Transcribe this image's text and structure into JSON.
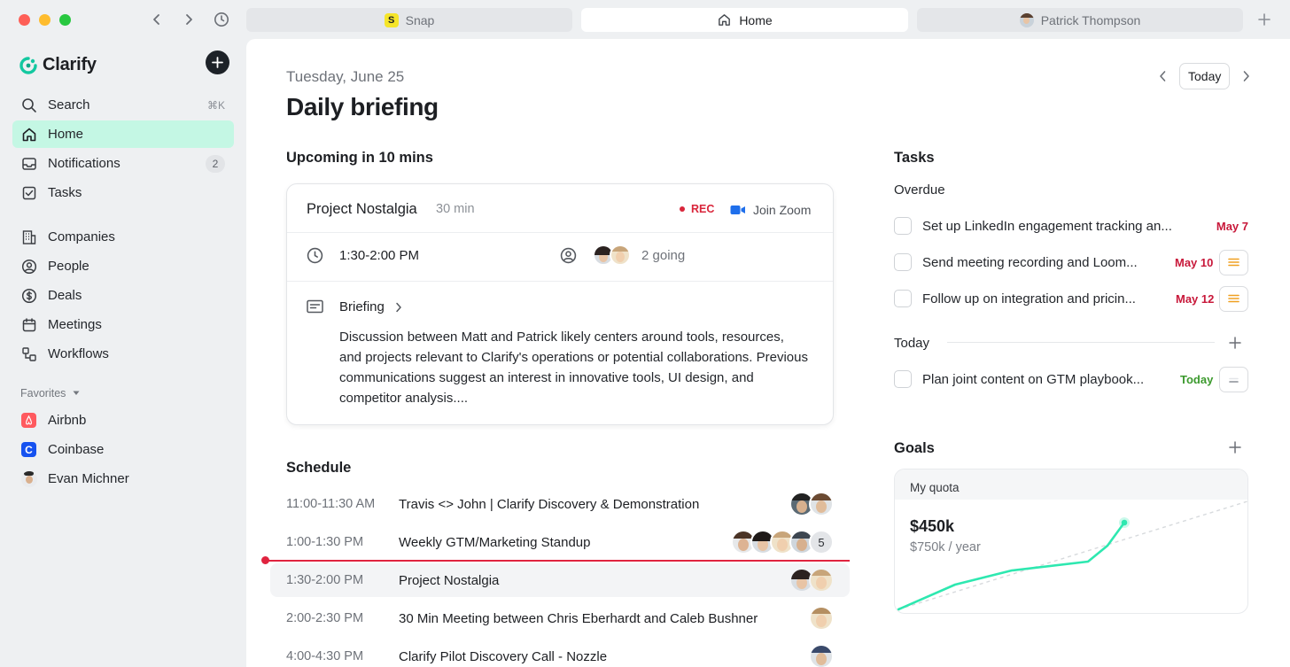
{
  "window": {
    "tabs": [
      {
        "label": "Snap",
        "badge": "S"
      },
      {
        "label": "Home"
      },
      {
        "label": "Patrick Thompson"
      }
    ]
  },
  "sidebar": {
    "app_name": "Clarify",
    "items": [
      {
        "label": "Search",
        "shortcut": "⌘K",
        "icon": "search-icon"
      },
      {
        "label": "Home",
        "icon": "home-icon"
      },
      {
        "label": "Notifications",
        "count": "2",
        "icon": "inbox-icon"
      },
      {
        "label": "Tasks",
        "icon": "checkbox-icon"
      },
      {
        "label": "Companies",
        "icon": "building-icon"
      },
      {
        "label": "People",
        "icon": "person-circle-icon"
      },
      {
        "label": "Deals",
        "icon": "dollar-icon"
      },
      {
        "label": "Meetings",
        "icon": "calendar-icon"
      },
      {
        "label": "Workflows",
        "icon": "workflow-icon"
      }
    ],
    "favorites_label": "Favorites",
    "favorites": [
      {
        "label": "Airbnb",
        "color": "#ff5a5f"
      },
      {
        "label": "Coinbase",
        "color": "#1652f0",
        "badge": "C"
      },
      {
        "label": "Evan Michner"
      }
    ]
  },
  "header": {
    "date": "Tuesday, June 25",
    "title": "Daily briefing",
    "today_button": "Today"
  },
  "upcoming": {
    "heading": "Upcoming in 10 mins",
    "meeting_name": "Project Nostalgia",
    "duration": "30 min",
    "rec_label": "REC",
    "join_label": "Join Zoom",
    "time": "1:30-2:00 PM",
    "going": "2 going",
    "briefing_label": "Briefing",
    "briefing_text": "Discussion between Matt and Patrick likely centers around tools, resources, and projects relevant to Clarify's operations or potential collaborations. Previous communications suggest an interest in innovative tools, UI design, and competitor analysis...."
  },
  "schedule": {
    "heading": "Schedule",
    "rows": [
      {
        "time": "11:00-11:30 AM",
        "name": "Travis <> John | Clarify Discovery & Demonstration"
      },
      {
        "time": "1:00-1:30 PM",
        "name": "Weekly GTM/Marketing Standup",
        "more": "5"
      },
      {
        "time": "1:30-2:00 PM",
        "name": "Project Nostalgia"
      },
      {
        "time": "2:00-2:30 PM",
        "name": "30 Min Meeting between Chris Eberhardt and Caleb Bushner"
      },
      {
        "time": "4:00-4:30 PM",
        "name": "Clarify Pilot Discovery Call - Nozzle"
      }
    ]
  },
  "tasks": {
    "heading": "Tasks",
    "overdue_label": "Overdue",
    "today_label": "Today",
    "overdue": [
      {
        "name": "Set up LinkedIn engagement tracking an...",
        "date": "May 7"
      },
      {
        "name": "Send meeting recording and Loom...",
        "date": "May 10"
      },
      {
        "name": "Follow up on integration and pricin...",
        "date": "May 12"
      }
    ],
    "today": [
      {
        "name": "Plan joint content on GTM playbook...",
        "date": "Today"
      }
    ],
    "colors": {
      "overdue": "#c8183a",
      "today": "#3c9a2e",
      "priority": "#f0a020"
    }
  },
  "goals": {
    "heading": "Goals",
    "card_label": "My quota",
    "amount": "$450k",
    "target": "$750k / year",
    "accent": "#2ee8b0"
  }
}
